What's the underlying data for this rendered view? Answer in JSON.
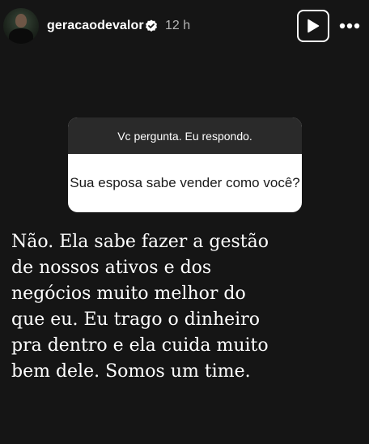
{
  "header": {
    "username": "geracaodevalor",
    "timestamp": "12 h",
    "avatar_icon": "profile-photo",
    "verified_icon": "verified-badge-icon",
    "play_icon": "play-icon",
    "more_icon": "more-dots-icon"
  },
  "question_sticker": {
    "title": "Vc pergunta. Eu respondo.",
    "question": "Sua esposa sabe vender como você?"
  },
  "answer": {
    "lines": [
      "Não. Ela sabe fazer a gestão",
      "de nossos ativos e dos",
      "negócios muito melhor do",
      "que eu. Eu trago o dinheiro",
      "pra dentro e ela cuida muito",
      "bem dele. Somos um time."
    ]
  },
  "colors": {
    "background": "#151515",
    "sticker_header": "#2a2a2a",
    "sticker_body": "#ffffff",
    "text_primary": "#ffffff",
    "text_secondary": "#b4b4b4"
  }
}
